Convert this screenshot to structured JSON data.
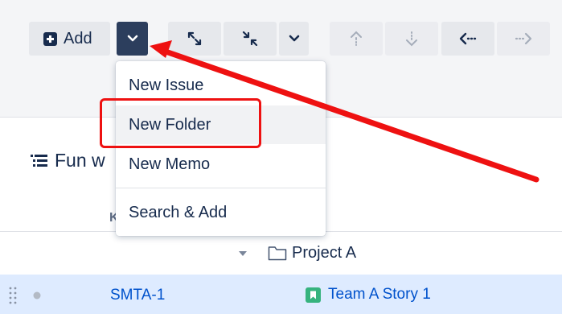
{
  "toolbar": {
    "add_label": "Add",
    "icons": [
      "plus-icon",
      "chevron-down-icon",
      "expand-icon",
      "collapse-icon",
      "chevron-down-icon",
      "arrow-up-icon",
      "arrow-down-icon",
      "arrow-left-icon",
      "arrow-right-icon"
    ]
  },
  "add_menu": {
    "items": [
      {
        "label": "New Issue"
      },
      {
        "label": "New Folder"
      },
      {
        "label": "New Memo"
      },
      {
        "label": "Search & Add"
      }
    ]
  },
  "structure": {
    "title": "Fun w"
  },
  "columns": {
    "key_header": "K"
  },
  "rows": {
    "folder": {
      "label": "Project A"
    },
    "issue": {
      "key": "SMTA-1",
      "summary": "Team A Story 1"
    }
  },
  "colors": {
    "primary_dark": "#2c3e5d",
    "link": "#0052cc",
    "story": "#36b37e",
    "selection": "#deebff",
    "annotation": "#ee1111"
  }
}
